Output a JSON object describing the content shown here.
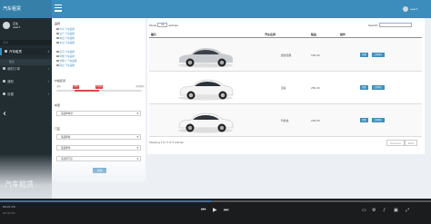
{
  "app": {
    "brand": "汽车租赁",
    "user_name": "user7",
    "footer_title": "汽车租赁"
  },
  "sidebar": {
    "user_line1": "正在",
    "user_line2": "user7",
    "header": "菜单",
    "items": [
      {
        "label": "汽车租赁",
        "icon": "car-icon"
      },
      {
        "label": "租赁",
        "icon": "list-icon"
      },
      {
        "label": "我的订单",
        "icon": "order-icon"
      },
      {
        "label": "通知",
        "icon": "bell-icon"
      },
      {
        "label": "设置",
        "icon": "gear-icon"
      }
    ],
    "sub_item": "租赁"
  },
  "filter": {
    "brand_label": "品牌",
    "brands": [
      "大众 汽车品牌",
      "日产 汽车品牌",
      "本田 汽车品牌",
      "丰田 汽车品牌",
      "宝马 汽车品牌",
      "奔驰 汽车品牌",
      "雪佛兰 汽车品牌",
      "别克 汽车品牌"
    ],
    "price_label": "价格区间",
    "price_min_tag": "¥0",
    "price_low_tag": "¥30",
    "price_high_tag": "¥100",
    "price_max_tag": "¥1000",
    "price_range": {
      "min": 0,
      "low": 30,
      "high": 100,
      "max": 1000
    },
    "type_label": "车型",
    "type_select": "请选择车型",
    "store_label": "门店",
    "province_select": "请选择省",
    "city_select": "请选择市",
    "store_select": "请选择门店",
    "search_button": "查询"
  },
  "table": {
    "show_label": "Show",
    "show_value": "10",
    "entries_label": "entries",
    "search_label": "Search:",
    "headers": [
      "图片",
      "汽车名称",
      "租金",
      "操作"
    ],
    "rows": [
      {
        "name": "朗逸经典",
        "price": "160.00",
        "action1": "查看",
        "action2": "立即预订"
      },
      {
        "name": "逍客",
        "price": "280.00",
        "action1": "查看",
        "action2": "立即预订"
      },
      {
        "name": "科鲁兹",
        "price": "200.00",
        "action1": "查看",
        "action2": "立即预订"
      }
    ],
    "info": "Showing 1 to 3 of 3 entries",
    "prev": "Previous",
    "next": "Next"
  },
  "player": {
    "time_current": "00:21:16",
    "time_total": "00:43:52",
    "progress": 0.49
  },
  "colors": {
    "header": "#3c8dbc",
    "sidebar": "#222d32",
    "accent_red": "#e04646"
  }
}
